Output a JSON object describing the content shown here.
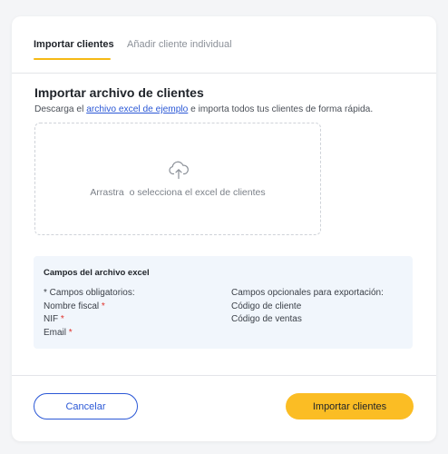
{
  "tabs": {
    "active": "Importar clientes",
    "inactive": "Añadir cliente individual"
  },
  "section": {
    "title": "Importar archivo de clientes",
    "desc_prefix": "Descarga el ",
    "desc_link": "archivo excel de ejemplo",
    "desc_suffix": " e importa todos tus clientes de forma rápida."
  },
  "dropzone": {
    "icon": "cloud-upload-icon",
    "text": "Arrastra  o selecciona el excel de clientes"
  },
  "fields": {
    "title": "Campos del archivo excel",
    "required_header": "* Campos obligatorios:",
    "required": [
      "Nombre fiscal",
      "NIF",
      "Email"
    ],
    "required_marker": "*",
    "optional_header": "Campos opcionales para exportación:",
    "optional": [
      "Código de cliente",
      "Código de ventas"
    ]
  },
  "footer": {
    "cancel_label": "Cancelar",
    "import_label": "Importar clientes"
  },
  "colors": {
    "accent": "#fbbd24",
    "link": "#2b58d6",
    "required": "#e0312b",
    "info_bg": "#f1f6fc"
  }
}
